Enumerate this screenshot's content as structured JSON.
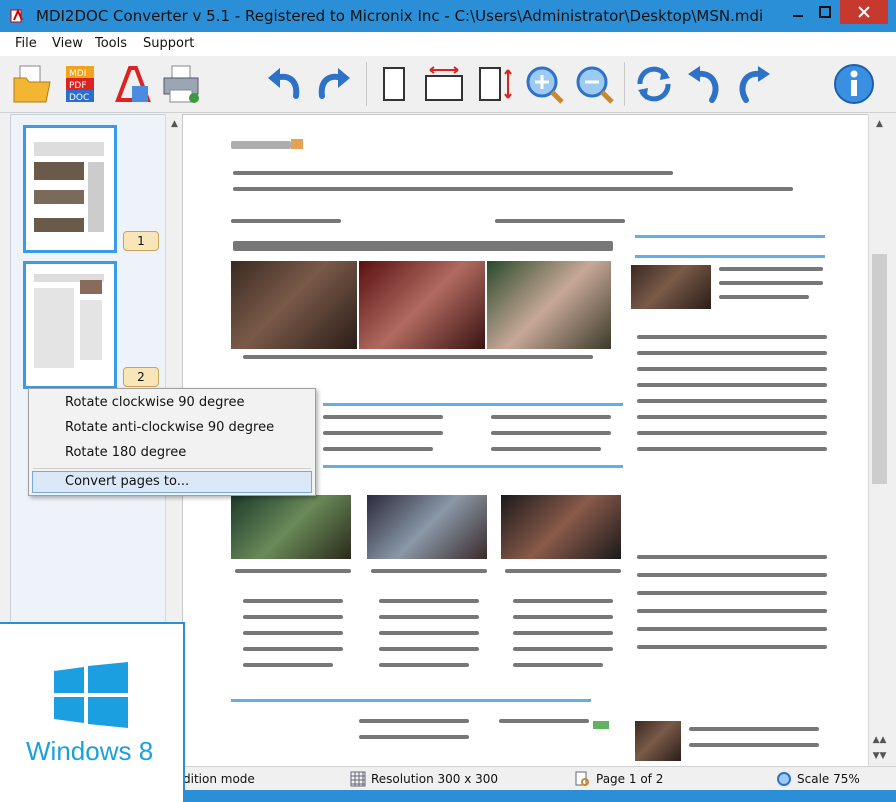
{
  "window": {
    "title": "MDI2DOC Converter v 5.1  -  Registered to Micronix Inc  -  C:\\Users\\Administrator\\Desktop\\MSN.mdi",
    "minimize_icon": "minimize-icon",
    "maximize_icon": "maximize-icon",
    "close_icon": "close-icon"
  },
  "menu": {
    "items": [
      "File",
      "View",
      "Tools",
      "Support"
    ]
  },
  "toolbar": {
    "buttons": [
      "open-folder-icon",
      "mdi-pdf-doc-icon",
      "pdf-convert-icon",
      "print-icon",
      "undo-icon",
      "redo-icon",
      "fit-page-icon",
      "fit-width-icon",
      "fit-height-icon",
      "zoom-in-icon",
      "zoom-out-icon",
      "rotate-icon",
      "rotate-left-icon",
      "rotate-right-icon",
      "info-icon"
    ]
  },
  "thumbnails": {
    "pages": [
      {
        "badge": "1"
      },
      {
        "badge": "2"
      }
    ]
  },
  "context_menu": {
    "items": [
      "Rotate clockwise 90 degree",
      "Rotate anti-clockwise 90 degree",
      "Rotate 180 degree",
      "Convert pages to..."
    ]
  },
  "status": {
    "mode": "dition mode",
    "resolution": "Resolution 300 x 300",
    "page": "Page 1 of 2",
    "scale": "Scale 75%"
  },
  "overlay": {
    "badge_text": "Windows 8"
  },
  "colors": {
    "accent": "#2b8fd8",
    "close": "#c7392e",
    "thumb_border": "#3c9be6",
    "badge": "#f8e6b8"
  }
}
